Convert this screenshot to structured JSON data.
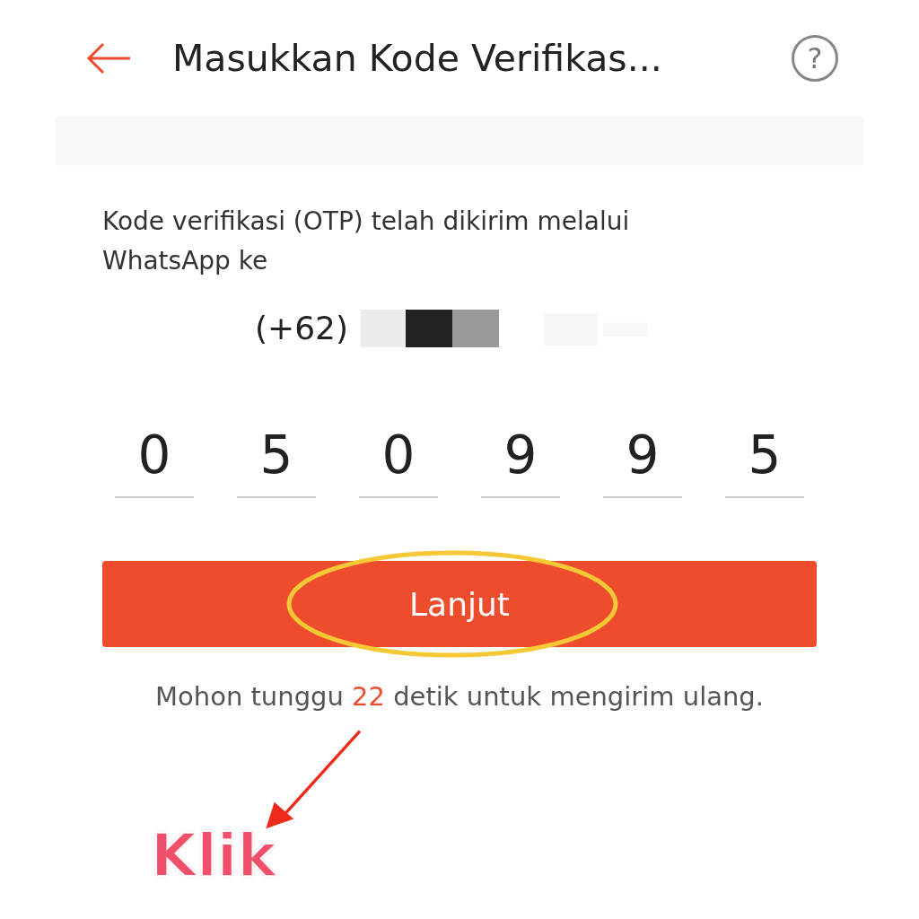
{
  "header": {
    "title": "Masukkan Kode Verifikas...",
    "help_icon": "?"
  },
  "message": "Kode verifikasi (OTP) telah dikirim melalui WhatsApp ke",
  "phone": {
    "country_code": "(+62)"
  },
  "otp_digits": [
    "0",
    "5",
    "0",
    "9",
    "9",
    "5"
  ],
  "submit_button": "Lanjut",
  "resend": {
    "prefix": "Mohon tunggu",
    "seconds": "22",
    "suffix": "detik untuk mengirim ulang."
  },
  "annotation": {
    "label": "Klik"
  }
}
